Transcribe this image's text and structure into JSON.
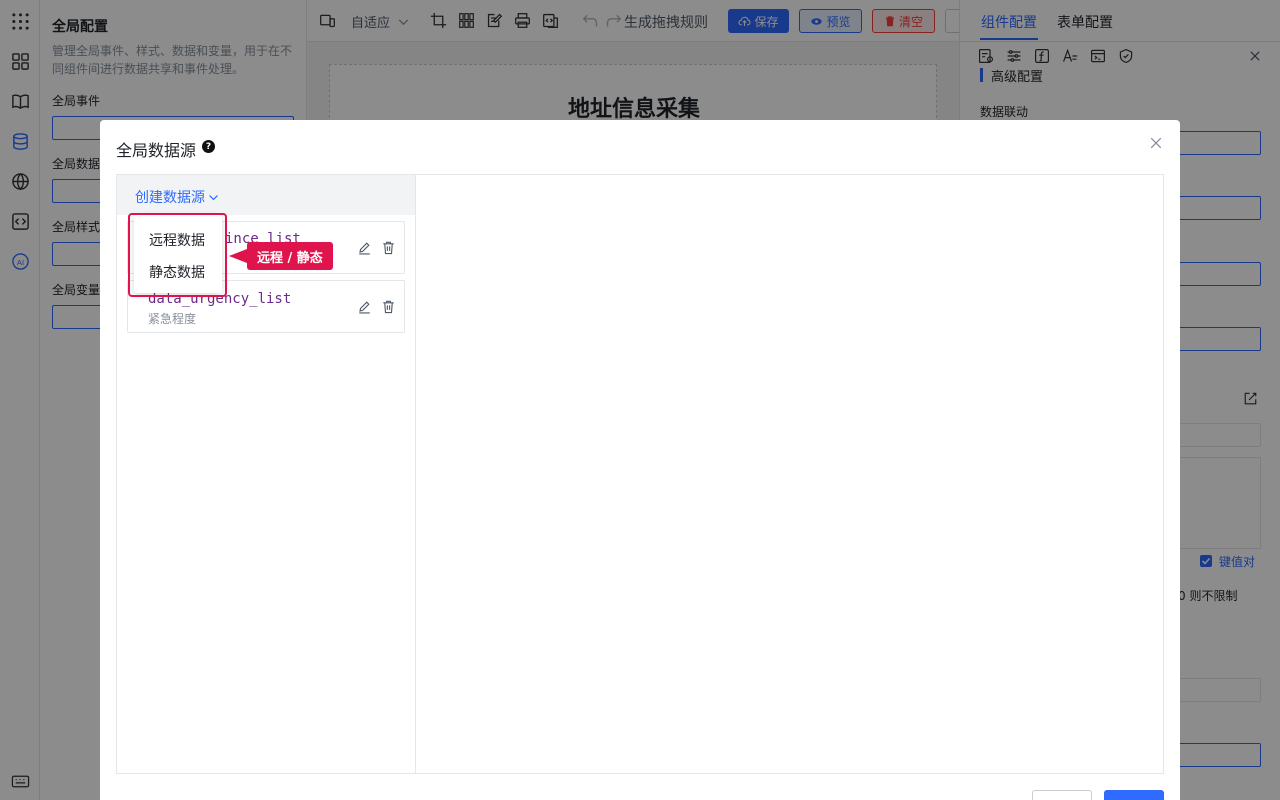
{
  "global_panel": {
    "title": "全局配置",
    "description": "管理全局事件、样式、数据和变量，用于在不同组件间进行数据共享和事件处理。",
    "sections": [
      "全局事件",
      "全局数据",
      "全局样式",
      "全局变量"
    ]
  },
  "toolbar": {
    "layout_mode": "自适应",
    "generate_rules": "生成拖拽规则",
    "save": "保存",
    "preview": "预览",
    "clear": "清空"
  },
  "canvas": {
    "form_title": "地址信息采集"
  },
  "right_panel": {
    "tabs": [
      "组件配置",
      "表单配置"
    ],
    "section_title": "高级配置",
    "linkage_label": "数据联动",
    "kv_checkbox": "键值对",
    "limit_hint": "0 则不限制"
  },
  "modal": {
    "title": "全局数据源",
    "help_icon": "?",
    "create_label": "创建数据源",
    "dropdown_options": [
      "远程数据",
      "静态数据"
    ],
    "callout": "远程 / 静态",
    "datasources": [
      {
        "name": "data_province_list",
        "visible_name": "ince_list",
        "desc": ""
      },
      {
        "name": "data_urgency_list",
        "visible_name": "data_urgency_list",
        "desc": "紧急程度"
      }
    ],
    "colors": {
      "primary": "#2f6bff",
      "highlight": "#e0144c",
      "code": "#6b2b8a"
    }
  }
}
